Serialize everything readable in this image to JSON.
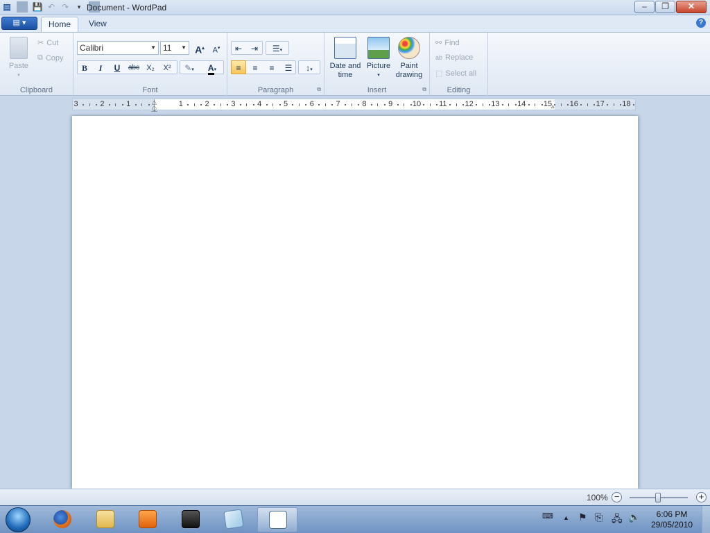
{
  "window": {
    "title": "Document - WordPad",
    "minimize_label": "–",
    "maximize_label": "❐",
    "close_label": "✕"
  },
  "quick_access": {
    "save_icon": "floppy-disk-icon",
    "undo_icon": "undo-icon",
    "redo_icon": "redo-icon",
    "customize_icon": "dropdown-arrow-icon"
  },
  "tabs": {
    "file_label": "▤ ▾",
    "home": "Home",
    "view": "View",
    "help_label": "?"
  },
  "clipboard": {
    "paste": "Paste",
    "cut": "Cut",
    "copy": "Copy",
    "group": "Clipboard"
  },
  "font": {
    "family": "Calibri",
    "size": "11",
    "grow_label": "A",
    "shrink_label": "A",
    "bold": "B",
    "italic": "I",
    "underline": "U",
    "strikethrough": "abc",
    "subscript": "X₂",
    "superscript": "X²",
    "text_color_label": "A",
    "group": "Font",
    "text_color": "#000000",
    "highlight_color": "#ffffff"
  },
  "paragraph": {
    "group": "Paragraph"
  },
  "insert": {
    "date_time_line1": "Date and",
    "date_time_line2": "time",
    "picture": "Picture",
    "paint_line1": "Paint",
    "paint_line2": "drawing",
    "group": "Insert"
  },
  "editing": {
    "find": "Find",
    "replace": "Replace",
    "select_all": "Select all",
    "group": "Editing"
  },
  "ruler": {
    "ticks": [
      "3",
      "2",
      "1",
      "1",
      "2",
      "3",
      "4",
      "5",
      "6",
      "7",
      "8",
      "9",
      "10",
      "11",
      "12",
      "13",
      "14",
      "15",
      "16",
      "17",
      "18"
    ]
  },
  "status": {
    "zoom": "100%",
    "zoom_out_label": "−",
    "zoom_in_label": "+",
    "zoom_level": 1.0
  },
  "taskbar": {
    "time": "6:06 PM",
    "date": "29/05/2010",
    "apps": [
      "firefox-icon",
      "file-explorer-icon",
      "media-player-icon",
      "camera-icon",
      "notepad-icon",
      "wordpad-icon"
    ],
    "active_app": "wordpad-icon"
  }
}
